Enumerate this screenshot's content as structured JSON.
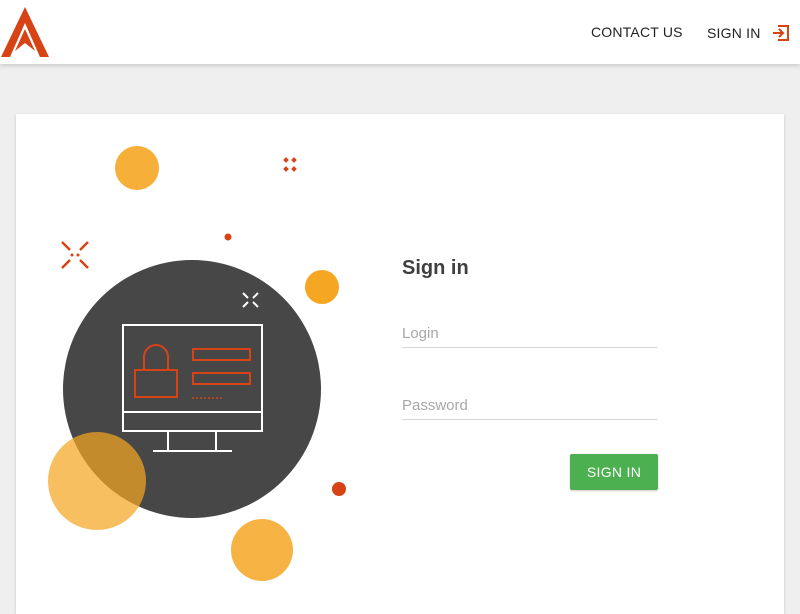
{
  "header": {
    "logo_icon": "brand-a-logo-icon",
    "nav": {
      "contact_label": "CONTACT US",
      "signin_label": "SIGN IN",
      "signin_icon": "sign-in-icon"
    }
  },
  "signin_form": {
    "title": "Sign in",
    "login": {
      "placeholder": "Login",
      "value": ""
    },
    "password": {
      "placeholder": "Password",
      "value": ""
    },
    "submit_label": "SIGN IN"
  },
  "illustration": {
    "icon": "computer-lock-illustration-icon"
  },
  "colors": {
    "brand_red": "#d84315",
    "accent_orange": "#f5a623",
    "dark_circle": "#474747",
    "button_green": "#4caf50"
  }
}
